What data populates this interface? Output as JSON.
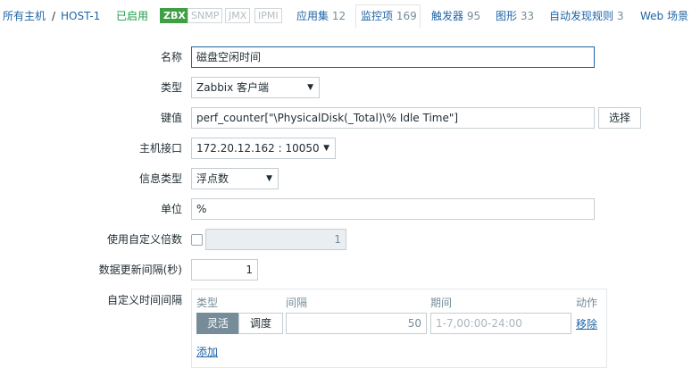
{
  "nav": {
    "all_hosts": "所有主机",
    "separator": "/",
    "host": "HOST-1",
    "status": "已启用",
    "badges": [
      "ZBX",
      "SNMP",
      "JMX",
      "IPMI"
    ],
    "tabs": [
      {
        "label": "应用集",
        "count": "12"
      },
      {
        "label": "监控项",
        "count": "169"
      },
      {
        "label": "触发器",
        "count": "95"
      },
      {
        "label": "图形",
        "count": "33"
      },
      {
        "label": "自动发现规则",
        "count": "3"
      },
      {
        "label": "Web 场景",
        "count": ""
      }
    ]
  },
  "form": {
    "name_label": "名称",
    "name_value": "磁盘空闲时间",
    "type_label": "类型",
    "type_value": "Zabbix 客户端",
    "key_label": "键值",
    "key_value": "perf_counter[\"\\PhysicalDisk(_Total)\\% Idle Time\"]",
    "key_select_button": "选择",
    "interface_label": "主机接口",
    "interface_value": "172.20.12.162 : 10050",
    "info_type_label": "信息类型",
    "info_type_value": "浮点数",
    "units_label": "单位",
    "units_value": "%",
    "multiplier_label": "使用自定义倍数",
    "multiplier_value": "1",
    "update_interval_label": "数据更新间隔(秒)",
    "update_interval_value": "1",
    "custom_intervals_label": "自定义时间间隔"
  },
  "intervals": {
    "col_type": "类型",
    "col_interval": "间隔",
    "col_period": "期间",
    "col_action": "动作",
    "mode_flexible": "灵活",
    "mode_scheduling": "调度",
    "interval_value": "50",
    "period_placeholder": "1-7,00:00-24:00",
    "remove_link": "移除",
    "add_link": "添加"
  },
  "colors": {
    "link": "#1f65a6",
    "enabled": "#1a9c4a",
    "zbx_badge": "#3f9f45",
    "segment_active": "#768d99"
  },
  "icons": {
    "dropdown": "caret-down-icon"
  }
}
